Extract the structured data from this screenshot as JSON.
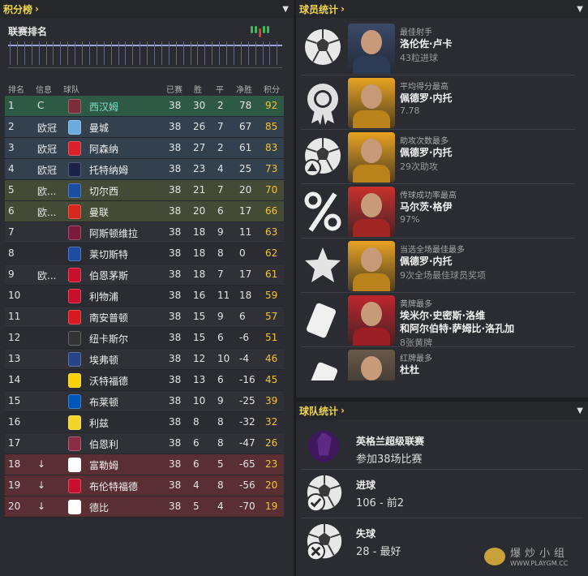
{
  "left": {
    "title": "积分榜",
    "subtitle": "联赛排名",
    "headers": {
      "pos": "排名",
      "info": "信息",
      "team": "球队",
      "played": "已赛",
      "won": "胜",
      "drawn": "平",
      "gd": "净胜",
      "pts": "积分"
    },
    "rows": [
      {
        "pos": "1",
        "info": "C",
        "team": "西汉姆",
        "p": "38",
        "w": "30",
        "d": "2",
        "gd": "78",
        "pts": "92",
        "zone": "green",
        "crest": "#7c2c3b"
      },
      {
        "pos": "2",
        "info": "欧冠",
        "team": "曼城",
        "p": "38",
        "w": "26",
        "d": "7",
        "gd": "67",
        "pts": "85",
        "zone": "blue",
        "crest": "#6cabdd"
      },
      {
        "pos": "3",
        "info": "欧冠",
        "team": "阿森纳",
        "p": "38",
        "w": "27",
        "d": "2",
        "gd": "61",
        "pts": "83",
        "zone": "blue",
        "crest": "#d8212a"
      },
      {
        "pos": "4",
        "info": "欧冠",
        "team": "托特纳姆",
        "p": "38",
        "w": "23",
        "d": "4",
        "gd": "25",
        "pts": "73",
        "zone": "blue",
        "crest": "#1b2147"
      },
      {
        "pos": "5",
        "info": "欧...",
        "team": "切尔西",
        "p": "38",
        "w": "21",
        "d": "7",
        "gd": "20",
        "pts": "70",
        "zone": "olive",
        "crest": "#1a4ea0"
      },
      {
        "pos": "6",
        "info": "欧...",
        "team": "曼联",
        "p": "38",
        "w": "20",
        "d": "6",
        "gd": "17",
        "pts": "66",
        "zone": "olive",
        "crest": "#d6281e"
      },
      {
        "pos": "7",
        "info": "",
        "team": "阿斯顿维拉",
        "p": "38",
        "w": "18",
        "d": "9",
        "gd": "11",
        "pts": "63",
        "zone": "none",
        "crest": "#7b1a3a"
      },
      {
        "pos": "8",
        "info": "",
        "team": "莱切斯特",
        "p": "38",
        "w": "18",
        "d": "8",
        "gd": "0",
        "pts": "62",
        "zone": "none",
        "crest": "#1d4ca0"
      },
      {
        "pos": "9",
        "info": "欧...",
        "team": "伯恩茅斯",
        "p": "38",
        "w": "18",
        "d": "7",
        "gd": "17",
        "pts": "61",
        "zone": "none",
        "crest": "#c8102e"
      },
      {
        "pos": "10",
        "info": "",
        "team": "利物浦",
        "p": "38",
        "w": "16",
        "d": "11",
        "gd": "18",
        "pts": "59",
        "zone": "none",
        "crest": "#c8102e"
      },
      {
        "pos": "11",
        "info": "",
        "team": "南安普顿",
        "p": "38",
        "w": "15",
        "d": "9",
        "gd": "6",
        "pts": "57",
        "zone": "none",
        "crest": "#d71920"
      },
      {
        "pos": "12",
        "info": "",
        "team": "纽卡斯尔",
        "p": "38",
        "w": "15",
        "d": "6",
        "gd": "-6",
        "pts": "51",
        "zone": "none",
        "crest": "#333333"
      },
      {
        "pos": "13",
        "info": "",
        "team": "埃弗顿",
        "p": "38",
        "w": "12",
        "d": "10",
        "gd": "-4",
        "pts": "46",
        "zone": "none",
        "crest": "#274488"
      },
      {
        "pos": "14",
        "info": "",
        "team": "沃特福德",
        "p": "38",
        "w": "13",
        "d": "6",
        "gd": "-16",
        "pts": "45",
        "zone": "none",
        "crest": "#f5d10a"
      },
      {
        "pos": "15",
        "info": "",
        "team": "布莱顿",
        "p": "38",
        "w": "10",
        "d": "9",
        "gd": "-25",
        "pts": "39",
        "zone": "none",
        "crest": "#0057b8"
      },
      {
        "pos": "16",
        "info": "",
        "team": "利兹",
        "p": "38",
        "w": "8",
        "d": "8",
        "gd": "-32",
        "pts": "32",
        "zone": "none",
        "crest": "#f2d52a"
      },
      {
        "pos": "17",
        "info": "",
        "team": "伯恩利",
        "p": "38",
        "w": "6",
        "d": "8",
        "gd": "-47",
        "pts": "26",
        "zone": "none",
        "crest": "#8a2b48"
      },
      {
        "pos": "18",
        "info": "↓",
        "team": "富勒姆",
        "p": "38",
        "w": "6",
        "d": "5",
        "gd": "-65",
        "pts": "23",
        "zone": "red",
        "crest": "#ffffff"
      },
      {
        "pos": "19",
        "info": "↓",
        "team": "布伦特福德",
        "p": "38",
        "w": "4",
        "d": "8",
        "gd": "-56",
        "pts": "20",
        "zone": "red",
        "crest": "#c8102e"
      },
      {
        "pos": "20",
        "info": "↓",
        "team": "德比",
        "p": "38",
        "w": "5",
        "d": "4",
        "gd": "-70",
        "pts": "19",
        "zone": "red",
        "crest": "#ffffff"
      }
    ]
  },
  "players": {
    "title": "球员统计",
    "items": [
      {
        "icon": "ball-icon",
        "l1": "最佳射手",
        "l2": "洛伦佐·卢卡",
        "l2b": "",
        "l3": "43粒进球",
        "photo": "#3a4a6a"
      },
      {
        "icon": "award-ribbon-icon",
        "l1": "平均得分最高",
        "l2": "佩德罗·内托",
        "l2b": "",
        "l3": "7.78",
        "photo": "#e8a321"
      },
      {
        "icon": "ball-assist-icon",
        "l1": "助攻次数最多",
        "l2": "佩德罗·内托",
        "l2b": "",
        "l3": "29次助攻",
        "photo": "#e8a321"
      },
      {
        "icon": "percent-icon",
        "l1": "传球成功率最高",
        "l2": "马尔茨·格伊",
        "l2b": "",
        "l3": "97%",
        "photo": "#c9302c"
      },
      {
        "icon": "star-icon",
        "l1": "当选全场最佳最多",
        "l2": "佩德罗·内托",
        "l2b": "",
        "l3": "9次全场最佳球员奖项",
        "photo": "#e8a321"
      },
      {
        "icon": "yellow-card-icon",
        "l1": "黄牌最多",
        "l2": "埃米尔·史密斯·洛维",
        "l2b": "和阿尔伯特·萨姆比·洛孔加",
        "l3": "8张黄牌",
        "photo": "#c0262c"
      },
      {
        "icon": "red-card-icon",
        "l1": "红牌最多",
        "l2": "杜杜",
        "l2b": "",
        "l3": "",
        "photo": "#6a5a48"
      }
    ]
  },
  "teamstats": {
    "title": "球队统计",
    "items": [
      {
        "icon": "premier-league-logo",
        "t1": "英格兰超级联赛",
        "t2": "参加38场比赛"
      },
      {
        "icon": "ball-check-icon",
        "t1": "进球",
        "t2": "106 - 前2"
      },
      {
        "icon": "ball-cross-icon",
        "t1": "失球",
        "t2": "28 - 最好"
      }
    ]
  },
  "watermark": {
    "text1": "爆炒小组",
    "text2": "WWW.PLAYGM.CC"
  }
}
